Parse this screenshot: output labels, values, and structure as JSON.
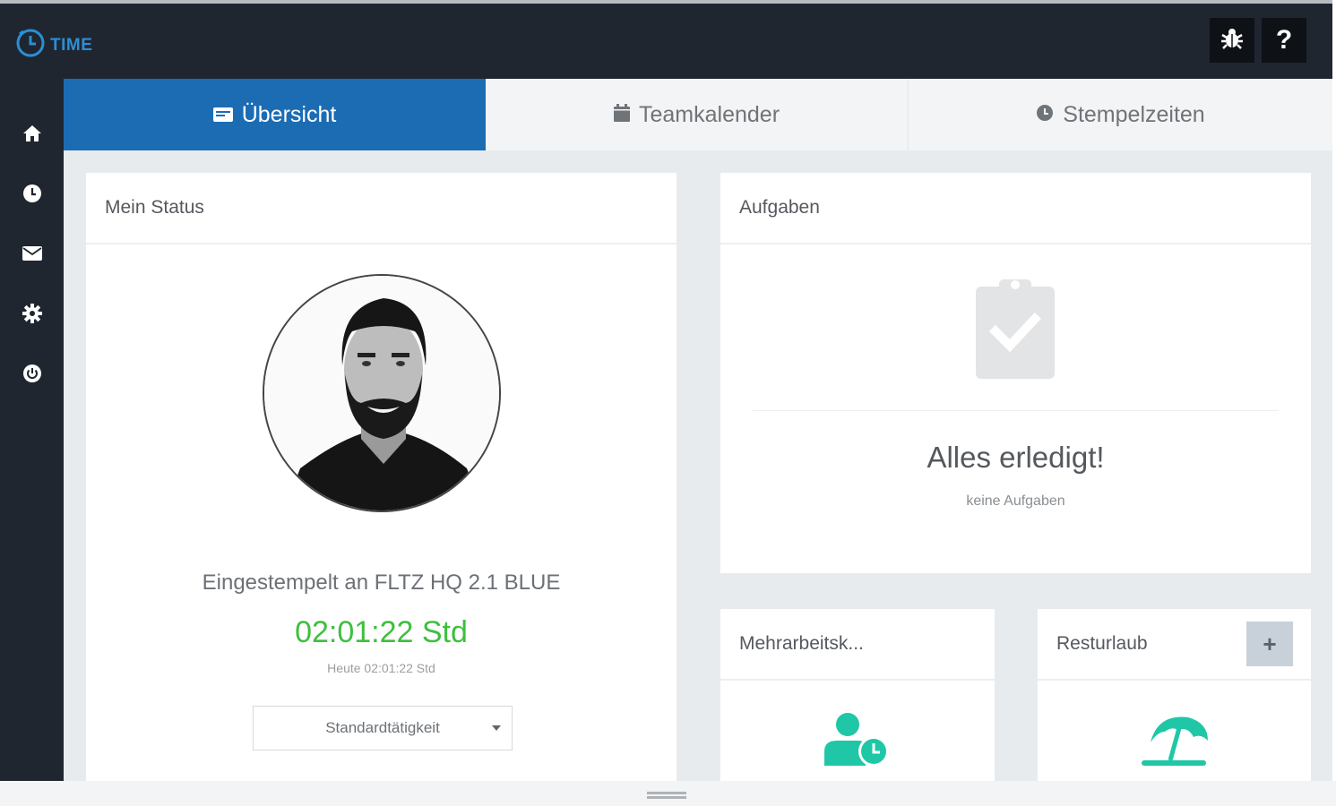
{
  "app": {
    "logo_text": "TIME"
  },
  "header": {
    "bug_icon": "bug-icon",
    "help_label": "?"
  },
  "sidebar": {
    "items": [
      {
        "icon": "home-icon"
      },
      {
        "icon": "clock-icon"
      },
      {
        "icon": "mail-icon"
      },
      {
        "icon": "gear-icon"
      },
      {
        "icon": "power-icon"
      }
    ]
  },
  "tabs": [
    {
      "label": "Übersicht",
      "icon": "overview-icon",
      "active": true
    },
    {
      "label": "Teamkalender",
      "icon": "calendar-icon",
      "active": false
    },
    {
      "label": "Stempelzeiten",
      "icon": "clock-icon",
      "active": false
    }
  ],
  "status_card": {
    "title": "Mein Status",
    "status_text": "Eingestempelt an FLTZ HQ 2.1 BLUE",
    "timer": "02:01:22 Std",
    "today": "Heute 02:01:22 Std",
    "activity_selected": "Standardtätigkeit"
  },
  "tasks_card": {
    "title": "Aufgaben",
    "empty_title": "Alles erledigt!",
    "empty_subtitle": "keine Aufgaben"
  },
  "overtime_card": {
    "title": "Mehrarbeitsk..."
  },
  "vacation_card": {
    "title": "Resturlaub",
    "add_label": "+"
  },
  "colors": {
    "accent": "#1c6cb4",
    "timer_green": "#3ebf3e",
    "teal_icon": "#1fc7a6",
    "nav_dark": "#1f2630"
  }
}
